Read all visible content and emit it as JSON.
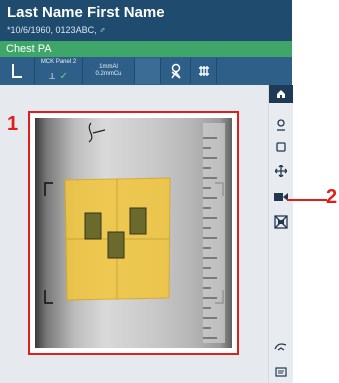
{
  "header": {
    "name": "Last Name First Name",
    "info": "*10/6/1960, 0123ABC, ♂"
  },
  "exam": {
    "label": "Chest PA"
  },
  "toolbar": {
    "panel_label": "MCK Panel 2",
    "filter_line1": "1mmAl",
    "filter_line2": "0.2mmCu"
  },
  "callouts": {
    "one": "1",
    "two": "2"
  },
  "colors": {
    "header": "#1e4b6e",
    "exam_bar": "#3fa66a",
    "toolbar": "#2e5f88",
    "callout": "#e01e1e",
    "overlay": "#f2c63a"
  },
  "sidebar": {
    "icons": [
      "home-icon",
      "person-icon",
      "square-icon",
      "move-icon",
      "camera-icon",
      "disabled-icon",
      "hand-icon",
      "comment-icon"
    ]
  }
}
